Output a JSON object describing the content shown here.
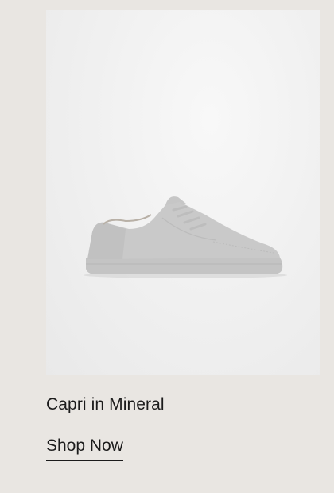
{
  "product": {
    "name": "Capri in Mineral",
    "image_alt": "sneaker-image",
    "background_color": "#e9e6e2"
  },
  "cta": {
    "label": "Shop Now"
  }
}
